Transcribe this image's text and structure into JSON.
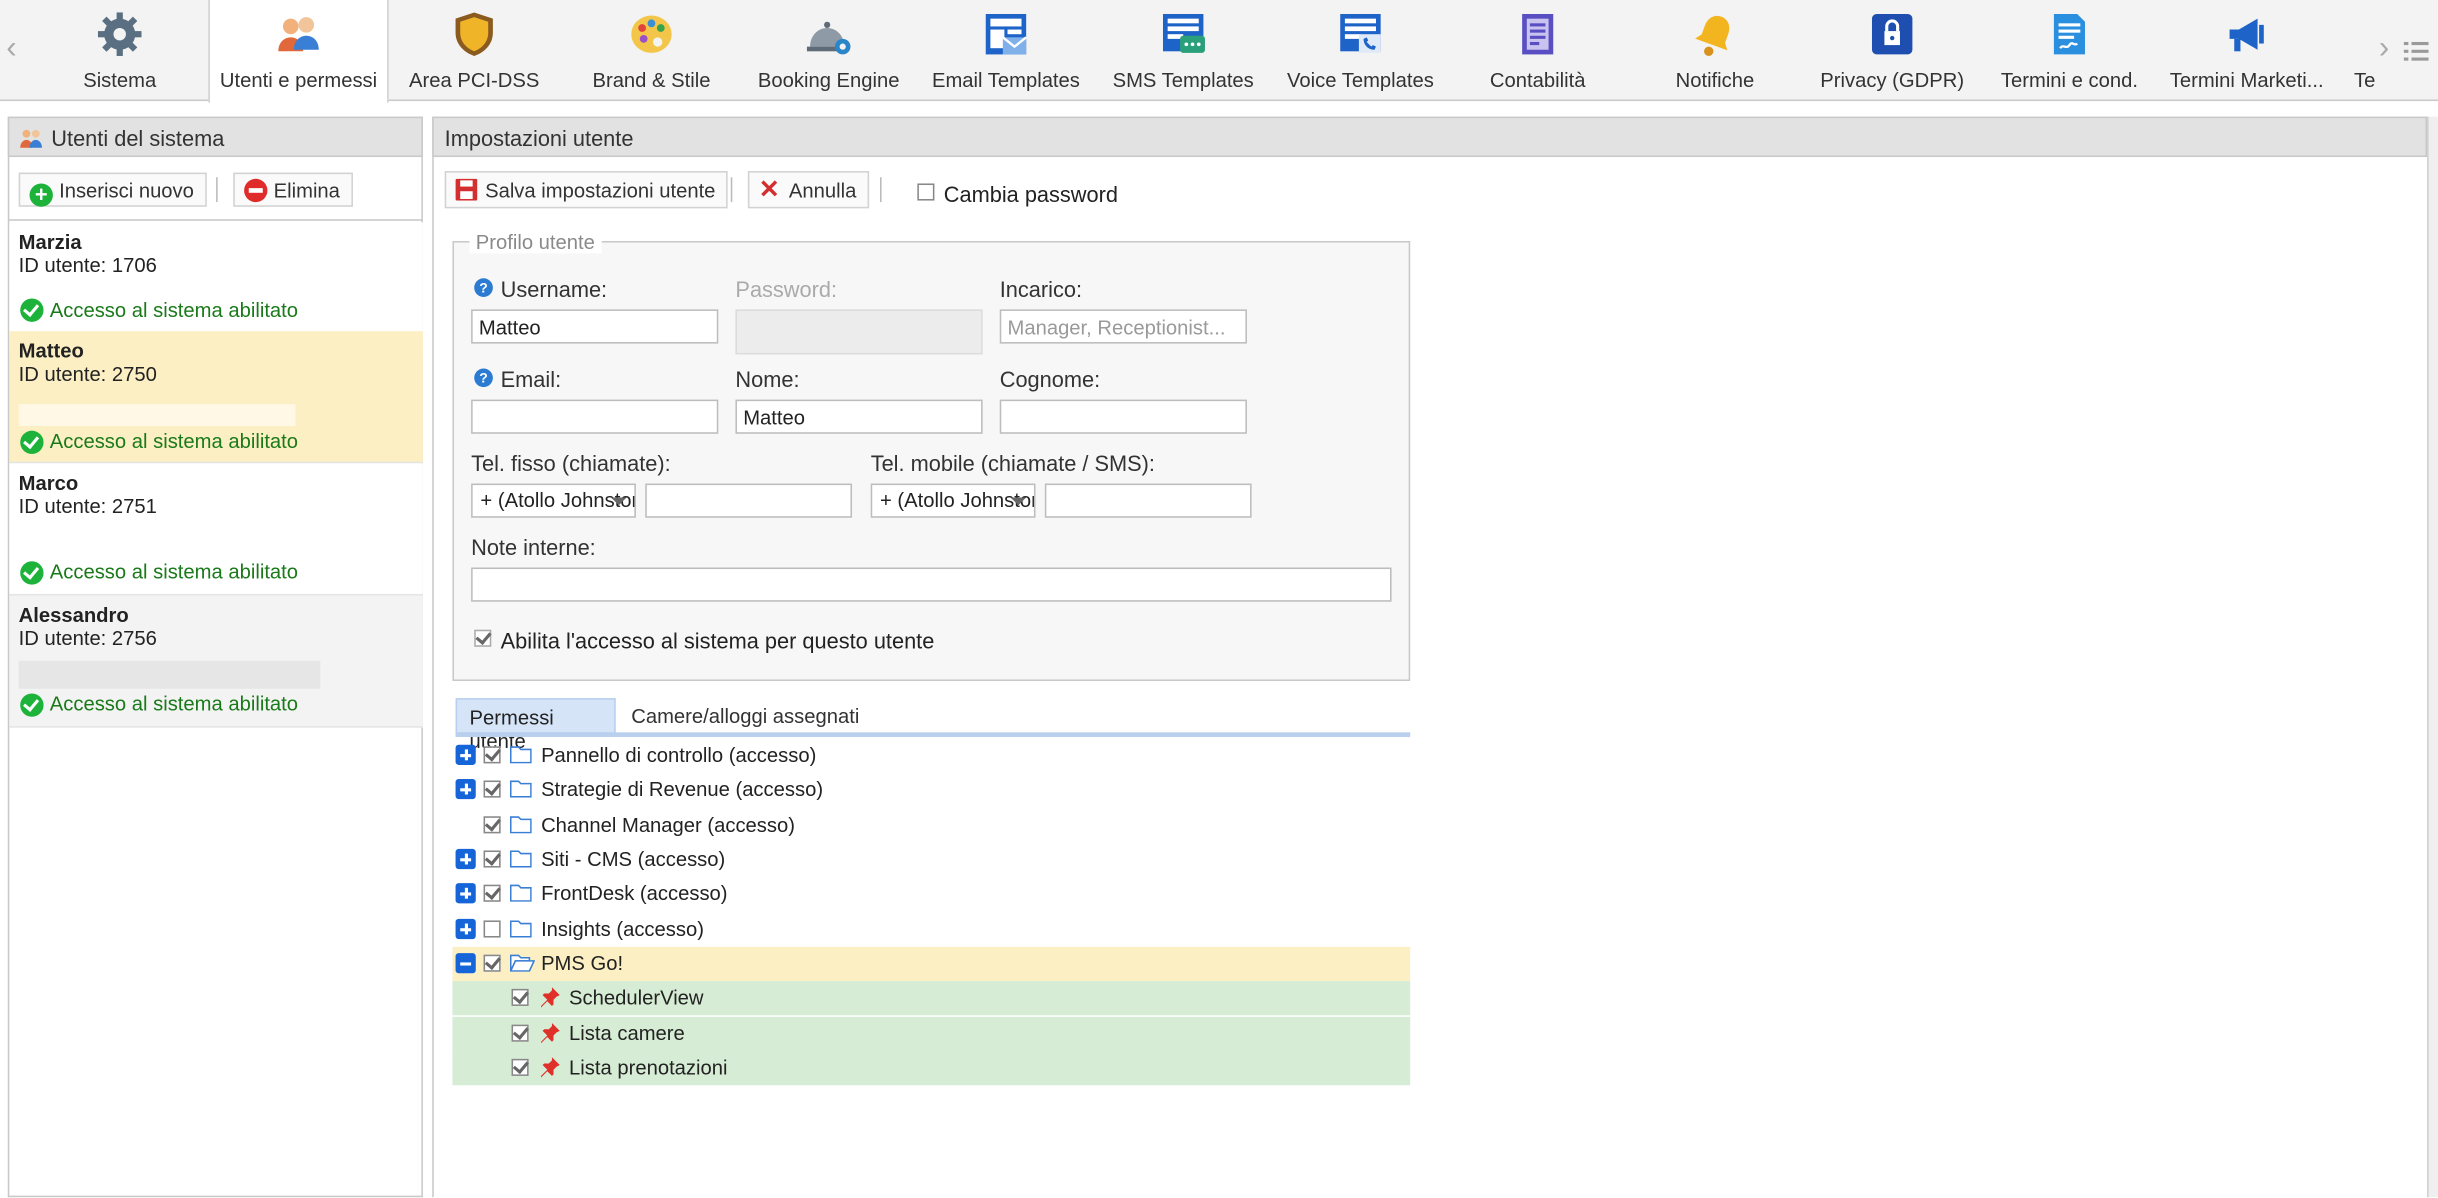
{
  "toolbar": {
    "tabs": [
      {
        "label": "Sistema",
        "icon": "gear-icon"
      },
      {
        "label": "Utenti e permessi",
        "icon": "users-icon",
        "active": true
      },
      {
        "label": "Area PCI-DSS",
        "icon": "shield-icon"
      },
      {
        "label": "Brand & Stile",
        "icon": "palette-icon"
      },
      {
        "label": "Booking Engine",
        "icon": "bell-gear-icon"
      },
      {
        "label": "Email Templates",
        "icon": "email-template-icon"
      },
      {
        "label": "SMS Templates",
        "icon": "sms-template-icon"
      },
      {
        "label": "Voice Templates",
        "icon": "voice-template-icon"
      },
      {
        "label": "Contabilità",
        "icon": "ledger-icon"
      },
      {
        "label": "Notifiche",
        "icon": "notification-bell-icon"
      },
      {
        "label": "Privacy (GDPR)",
        "icon": "privacy-lock-icon"
      },
      {
        "label": "Termini e cond.",
        "icon": "contract-icon"
      },
      {
        "label": "Termini Marketi...",
        "icon": "megaphone-icon"
      },
      {
        "label": "Te",
        "icon": ""
      }
    ]
  },
  "users_panel": {
    "title": "Utenti del sistema",
    "insert_label": "Inserisci nuovo",
    "delete_label": "Elimina",
    "users": [
      {
        "name": "Marzia",
        "id_text": "ID utente: 1706",
        "status": "Accesso al sistema abilitato"
      },
      {
        "name": "Matteo",
        "id_text": "ID utente: 2750",
        "status": "Accesso al sistema abilitato",
        "selected": true
      },
      {
        "name": "Marco",
        "id_text": "ID utente: 2751",
        "status": "Accesso al sistema abilitato"
      },
      {
        "name": "Alessandro",
        "id_text": "ID utente: 2756",
        "status": "Accesso al sistema abilitato"
      }
    ]
  },
  "settings": {
    "title": "Impostazioni utente",
    "save_label": "Salva impostazioni utente",
    "cancel_label": "Annulla",
    "change_password_label": "Cambia password",
    "profile_legend": "Profilo utente",
    "username_label": "Username:",
    "username_value": "Matteo",
    "password_label": "Password:",
    "incarico_label": "Incarico:",
    "incarico_placeholder": "Manager, Receptionist...",
    "email_label": "Email:",
    "email_value": "",
    "nome_label": "Nome:",
    "nome_value": "Matteo",
    "cognome_label": "Cognome:",
    "cognome_value": "",
    "tel_fisso_label": "Tel. fisso (chiamate):",
    "tel_mobile_label": "Tel. mobile (chiamate / SMS):",
    "country_select_value": "+ (Atollo Johnston)",
    "note_label": "Note interne:",
    "enable_access_label": "Abilita l'accesso al sistema per questo utente"
  },
  "permissions": {
    "tabs": [
      "Permessi utente",
      "Camere/alloggi assegnati"
    ],
    "tree": [
      {
        "label": "Pannello di controllo (accesso)",
        "checked": true,
        "expand": "plus"
      },
      {
        "label": "Strategie di Revenue (accesso)",
        "checked": true,
        "expand": "plus"
      },
      {
        "label": "Channel Manager (accesso)",
        "checked": true,
        "expand": ""
      },
      {
        "label": "Siti - CMS (accesso)",
        "checked": true,
        "expand": "plus"
      },
      {
        "label": "FrontDesk (accesso)",
        "checked": true,
        "expand": "plus"
      },
      {
        "label": "Insights (accesso)",
        "checked": false,
        "expand": "plus"
      },
      {
        "label": "PMS Go!",
        "checked": true,
        "expand": "minus",
        "highlight": "yellow"
      },
      {
        "label": "SchedulerView",
        "checked": true,
        "child": true
      },
      {
        "label": "Lista camere",
        "checked": true,
        "child": true
      },
      {
        "label": "Lista prenotazioni",
        "checked": true,
        "child": true
      }
    ]
  },
  "colors": {
    "selected_user_bg": "#fcefc4",
    "alt_user_bg": "#f3f3f3",
    "child_row_bg": "#d6ecd4",
    "highlight_row_bg": "#fcefc4",
    "status_green": "#1db33a",
    "tab_active_bg": "#d5e4f7"
  }
}
